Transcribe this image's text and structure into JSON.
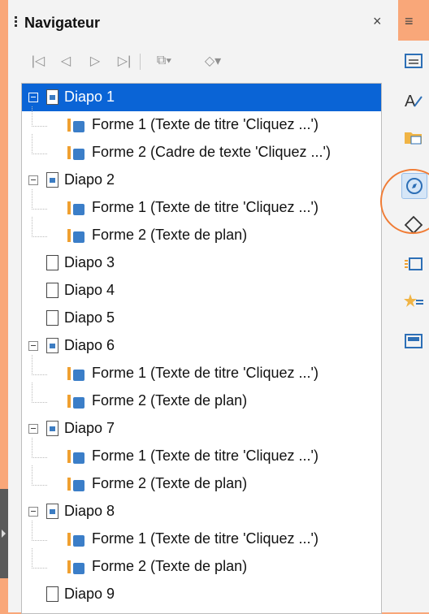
{
  "window": {
    "title": "Navigateur",
    "close": "×",
    "menu": "≡"
  },
  "toolbar": {
    "buttons": [
      {
        "icon": "first-icon",
        "glyph": "|◁"
      },
      {
        "icon": "previous-icon",
        "glyph": "◁"
      },
      {
        "icon": "next-icon",
        "glyph": "▷"
      },
      {
        "icon": "last-icon",
        "glyph": "▷|"
      },
      {
        "icon": "drag-mode-icon",
        "glyph": "⧉▾"
      },
      {
        "icon": "shape-filter-icon",
        "glyph": "◇▾"
      }
    ]
  },
  "tree": {
    "items": [
      {
        "label": "Diapo 1",
        "level": 0,
        "type": "slide",
        "expanded": true,
        "selected": true
      },
      {
        "label": "Forme 1 (Texte de titre 'Cliquez ...')",
        "level": 1,
        "type": "shape"
      },
      {
        "label": "Forme 2 (Cadre de texte 'Cliquez ...')",
        "level": 1,
        "type": "shape"
      },
      {
        "label": "Diapo 2",
        "level": 0,
        "type": "slide",
        "expanded": true
      },
      {
        "label": "Forme 1 (Texte de titre 'Cliquez ...')",
        "level": 1,
        "type": "shape"
      },
      {
        "label": "Forme 2 (Texte de plan)",
        "level": 1,
        "type": "shape"
      },
      {
        "label": "Diapo 3",
        "level": 0,
        "type": "page"
      },
      {
        "label": "Diapo 4",
        "level": 0,
        "type": "page"
      },
      {
        "label": "Diapo 5",
        "level": 0,
        "type": "page"
      },
      {
        "label": "Diapo 6",
        "level": 0,
        "type": "slide",
        "expanded": true
      },
      {
        "label": "Forme 1 (Texte de titre 'Cliquez ...')",
        "level": 1,
        "type": "shape"
      },
      {
        "label": "Forme 2 (Texte de plan)",
        "level": 1,
        "type": "shape"
      },
      {
        "label": "Diapo 7",
        "level": 0,
        "type": "slide",
        "expanded": true
      },
      {
        "label": "Forme 1 (Texte de titre 'Cliquez ...')",
        "level": 1,
        "type": "shape"
      },
      {
        "label": "Forme 2 (Texte de plan)",
        "level": 1,
        "type": "shape"
      },
      {
        "label": "Diapo 8",
        "level": 0,
        "type": "slide",
        "expanded": true
      },
      {
        "label": "Forme 1 (Texte de titre 'Cliquez ...')",
        "level": 1,
        "type": "shape"
      },
      {
        "label": "Forme 2 (Texte de plan)",
        "level": 1,
        "type": "shape"
      },
      {
        "label": "Diapo 9",
        "level": 0,
        "type": "page"
      }
    ]
  },
  "sidebar": {
    "buttons": [
      {
        "name": "properties-icon",
        "active": false
      },
      {
        "name": "styles-icon",
        "active": false
      },
      {
        "name": "gallery-icon",
        "active": false
      },
      {
        "name": "navigator-icon",
        "active": true
      },
      {
        "name": "shapes-icon",
        "active": false
      },
      {
        "name": "slide-transition-icon",
        "active": false
      },
      {
        "name": "animation-icon",
        "active": false
      },
      {
        "name": "master-slides-icon",
        "active": false
      }
    ]
  },
  "colors": {
    "selection": "#0a64d6",
    "accent_ring": "#f07c35",
    "background": "#f9a779"
  }
}
